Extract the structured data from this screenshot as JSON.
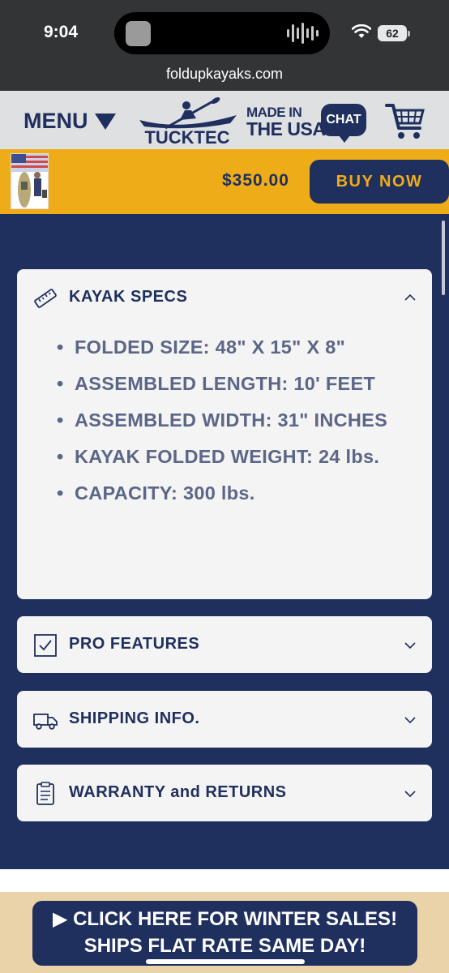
{
  "status": {
    "time": "9:04",
    "battery": "62"
  },
  "browser": {
    "url": "foldupkayaks.com"
  },
  "header": {
    "menu_label": "MENU",
    "logo_text": "TUCKTEC",
    "made_line1": "MADE IN",
    "made_line2": "THE USA",
    "chat_label": "CHAT"
  },
  "buybar": {
    "price": "$350.00",
    "buy_label": "BUY NOW"
  },
  "accordion": {
    "specs": {
      "title": "KAYAK SPECS",
      "items": [
        "FOLDED SIZE: 48\" X 15\" X 8\"",
        "ASSEMBLED LENGTH: 10' FEET",
        "ASSEMBLED WIDTH: 31\" INCHES",
        "KAYAK FOLDED WEIGHT: 24 lbs.",
        "CAPACITY: 300 lbs."
      ]
    },
    "pro": {
      "title": "PRO FEATURES"
    },
    "shipping": {
      "title": "SHIPPING INFO."
    },
    "warranty": {
      "title": "WARRANTY and RETURNS"
    }
  },
  "promo": {
    "line1": "CLICK HERE FOR WINTER SALES!",
    "line2": "SHIPS FLAT RATE SAME DAY!"
  },
  "colors": {
    "navy": "#1f2f5e",
    "gold": "#eeac19",
    "tan": "#ebd3a9"
  }
}
